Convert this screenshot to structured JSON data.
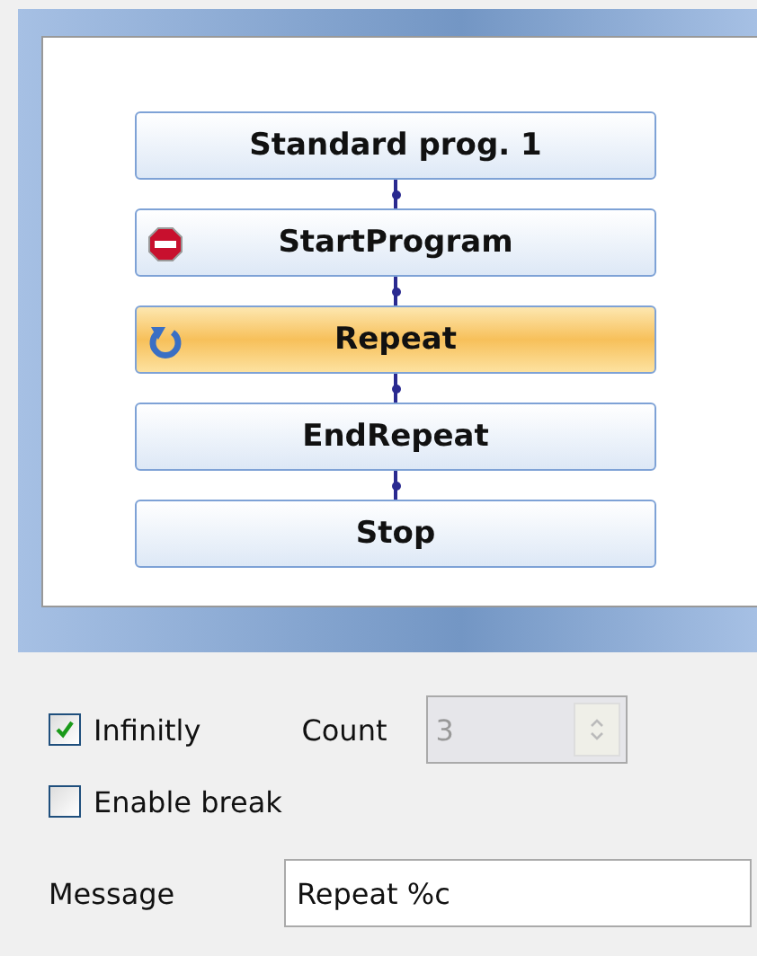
{
  "flow": {
    "nodes": [
      {
        "label": "Standard prog. 1",
        "kind": "plain",
        "selected": false
      },
      {
        "label": "StartProgram",
        "kind": "stop",
        "selected": false
      },
      {
        "label": "Repeat",
        "kind": "repeat",
        "selected": true
      },
      {
        "label": "EndRepeat",
        "kind": "plain",
        "selected": false
      },
      {
        "label": "Stop",
        "kind": "plain",
        "selected": false
      }
    ]
  },
  "options": {
    "infinitely": {
      "label": "Infinitly",
      "checked": true
    },
    "count": {
      "label": "Count",
      "value": "3",
      "disabled": true
    },
    "enable_break": {
      "label": "Enable break",
      "checked": false
    },
    "message": {
      "label": "Message",
      "value": "Repeat %c"
    }
  }
}
